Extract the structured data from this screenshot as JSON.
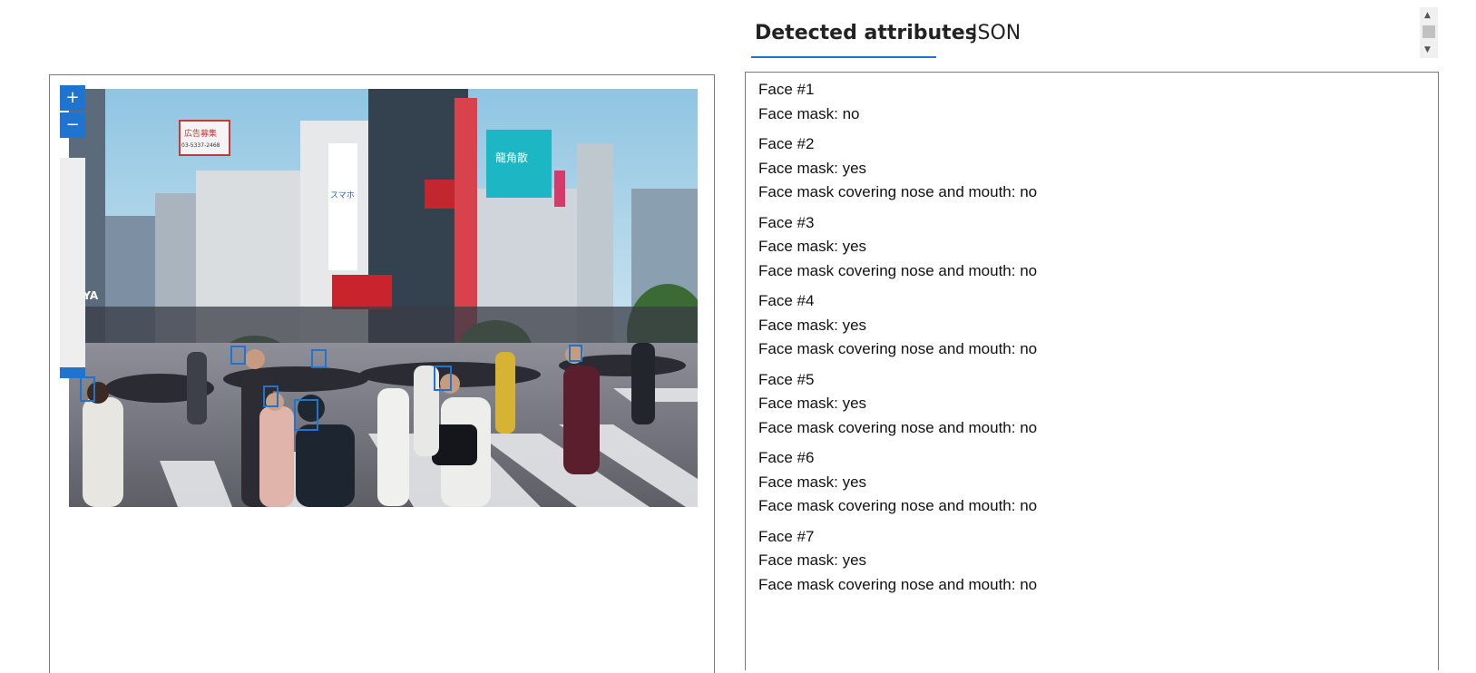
{
  "tabs": {
    "attributes_label": "Detected attributes",
    "json_label": "JSON"
  },
  "controls": {
    "zoom_in": "+",
    "zoom_out": "−",
    "zoom_level": 1.0
  },
  "photo": {
    "signs": {
      "billboard_top": "広告募集",
      "billboard_phone": "03-5337-2468",
      "tall_sign": "スマホ",
      "blue_sign": "龍角散",
      "store": "TAYA"
    }
  },
  "faces": [
    {
      "title": "Face #1",
      "mask": "Face mask: no",
      "covering": null
    },
    {
      "title": "Face #2",
      "mask": "Face mask: yes",
      "covering": "Face mask covering nose and mouth: no"
    },
    {
      "title": "Face #3",
      "mask": "Face mask: yes",
      "covering": "Face mask covering nose and mouth: no"
    },
    {
      "title": "Face #4",
      "mask": "Face mask: yes",
      "covering": "Face mask covering nose and mouth: no"
    },
    {
      "title": "Face #5",
      "mask": "Face mask: yes",
      "covering": "Face mask covering nose and mouth: no"
    },
    {
      "title": "Face #6",
      "mask": "Face mask: yes",
      "covering": "Face mask covering nose and mouth: no"
    },
    {
      "title": "Face #7",
      "mask": "Face mask: yes",
      "covering": "Face mask covering nose and mouth: no"
    }
  ],
  "colors": {
    "accent": "#1f74d0",
    "border": "#7a7a7a"
  }
}
